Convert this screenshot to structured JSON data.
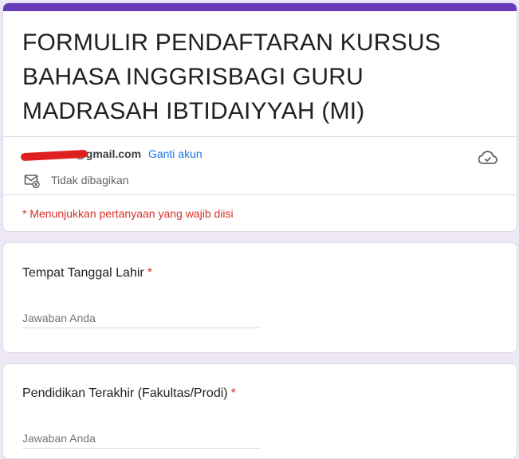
{
  "theme": {
    "accent": "#673ab7",
    "required": "#d93025",
    "link": "#1a73e8"
  },
  "form": {
    "title": "FORMULIR PENDAFTARAN KURSUS BAHASA INGGRISBAGI GURU MADRASAH IBTIDAIYYAH (MI)"
  },
  "account": {
    "email_hidden": "zulfikasury",
    "email_domain": "@gmail.com",
    "switch_label": "Ganti akun",
    "shared_status": "Tidak dibagikan"
  },
  "icons": {
    "cloud": "cloud-check-icon",
    "not_shared": "mail-not-shared-icon"
  },
  "required_note": "* Menunjukkan pertanyaan yang wajib diisi",
  "questions": [
    {
      "title": "Tempat Tanggal Lahir",
      "required_mark": "*",
      "placeholder": "Jawaban Anda"
    },
    {
      "title": "Pendidikan Terakhir (Fakultas/Prodi)",
      "required_mark": "*",
      "placeholder": "Jawaban Anda"
    }
  ]
}
